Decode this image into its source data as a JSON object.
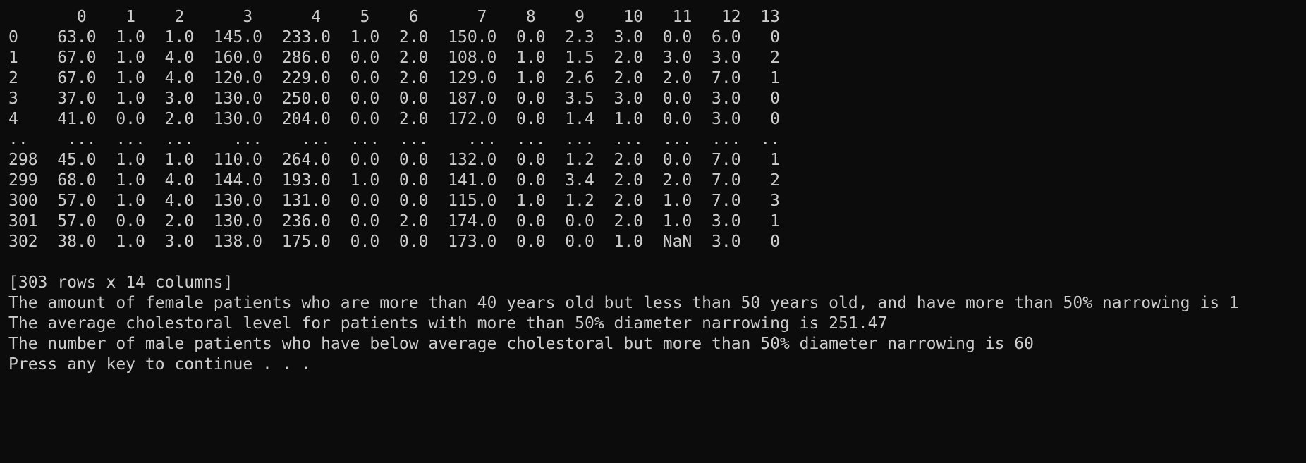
{
  "terminal": {
    "background": "#0c0c0c",
    "foreground": "#cccccc",
    "lines": [
      "       0    1    2      3      4    5    6      7    8    9    10   11   12  13",
      "0    63.0  1.0  1.0  145.0  233.0  1.0  2.0  150.0  0.0  2.3  3.0  0.0  6.0   0",
      "1    67.0  1.0  4.0  160.0  286.0  0.0  2.0  108.0  1.0  1.5  2.0  3.0  3.0   2",
      "2    67.0  1.0  4.0  120.0  229.0  0.0  2.0  129.0  1.0  2.6  2.0  2.0  7.0   1",
      "3    37.0  1.0  3.0  130.0  250.0  0.0  0.0  187.0  0.0  3.5  3.0  0.0  3.0   0",
      "4    41.0  0.0  2.0  130.0  204.0  0.0  2.0  172.0  0.0  1.4  1.0  0.0  3.0   0",
      "..    ...  ...  ...    ...    ...  ...  ...    ...  ...  ...  ...  ...  ...  ..",
      "298  45.0  1.0  1.0  110.0  264.0  0.0  0.0  132.0  0.0  1.2  2.0  0.0  7.0   1",
      "299  68.0  1.0  4.0  144.0  193.0  1.0  0.0  141.0  0.0  3.4  2.0  2.0  7.0   2",
      "300  57.0  1.0  4.0  130.0  131.0  0.0  0.0  115.0  1.0  1.2  2.0  1.0  7.0   3",
      "301  57.0  0.0  2.0  130.0  236.0  0.0  2.0  174.0  0.0  0.0  2.0  1.0  3.0   1",
      "302  38.0  1.0  3.0  138.0  175.0  0.0  0.0  173.0  0.0  0.0  1.0  NaN  3.0   0",
      "",
      "[303 rows x 14 columns]",
      "The amount of female patients who are more than 40 years old but less than 50 years old, and have more than 50% narrowing is 1",
      "The average cholestoral level for patients with more than 50% diameter narrowing is 251.47",
      "The number of male patients who have below average cholestoral but more than 50% diameter narrowing is 60",
      "Press any key to continue . . ."
    ]
  }
}
